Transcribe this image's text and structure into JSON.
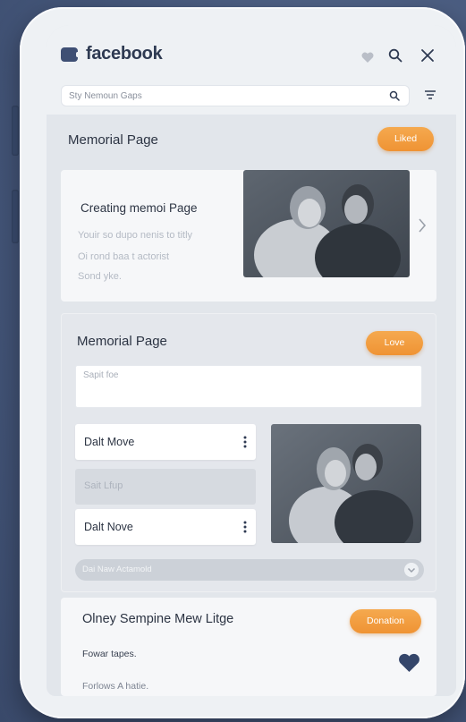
{
  "header": {
    "brand": "facebook",
    "search_placeholder": "Sty Nemoun Gaps"
  },
  "section_memorial": {
    "title": "Memorial Page",
    "liked_button": "Liked"
  },
  "featured_card": {
    "title": "Creating memoi Page",
    "lines": [
      "Youir so dupo nenis to titly",
      "Oi rond baa t actorist",
      "Sond yke."
    ]
  },
  "memorial_form": {
    "title": "Memorial Page",
    "love_button": "Love",
    "textarea_placeholder": "Sapit foe",
    "list_items": [
      {
        "label": "Dalt Move"
      },
      {
        "label": "Sait Lfup"
      },
      {
        "label": "Dalt Nove"
      }
    ],
    "dropdown_label": "Dai Naw Actamold"
  },
  "bottom_card": {
    "title": "Olney Sempine Mew Litge",
    "donation_button": "Donation",
    "line1": "Fowar tapes.",
    "line2": "Forlows A hatie."
  },
  "colors": {
    "accent_orange": "#f29a3c",
    "brand_navy": "#3e4f74",
    "background": "#46587c"
  }
}
